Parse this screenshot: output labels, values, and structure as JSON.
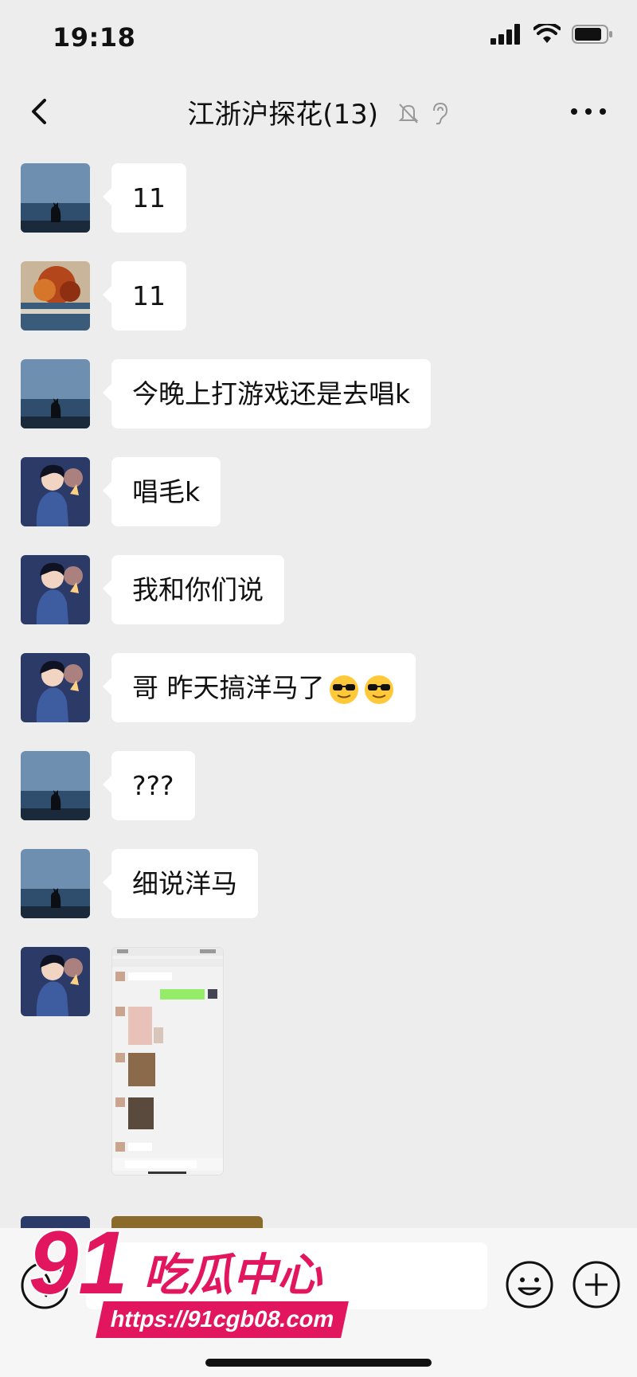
{
  "status_bar": {
    "time": "19:18"
  },
  "nav": {
    "title": "江浙沪探花(13)"
  },
  "messages": [
    {
      "avatar": "cat-silhouette-sea",
      "text": "11"
    },
    {
      "avatar": "autumn-tree-lake",
      "text": "11"
    },
    {
      "avatar": "cat-silhouette-sea",
      "text": "今晚上打游戏还是去唱k"
    },
    {
      "avatar": "anime-character-portrait",
      "text": "唱毛k"
    },
    {
      "avatar": "anime-character-portrait",
      "text": "我和你们说"
    },
    {
      "avatar": "anime-character-portrait",
      "text": "哥 昨天搞洋马了",
      "emoji": [
        "sunglasses-emoji",
        "sunglasses-emoji"
      ]
    },
    {
      "avatar": "cat-silhouette-sea",
      "text": "???"
    },
    {
      "avatar": "cat-silhouette-sea",
      "text": "细说洋马"
    },
    {
      "avatar": "anime-character-portrait",
      "image": "chat-screenshot-thumbnail"
    }
  ],
  "watermark": {
    "number": "91",
    "brand": "吃瓜中心",
    "url": "https://91cgb08.com"
  },
  "colors": {
    "background": "#ededed",
    "bubble": "#ffffff",
    "watermark": "#e2165f"
  }
}
